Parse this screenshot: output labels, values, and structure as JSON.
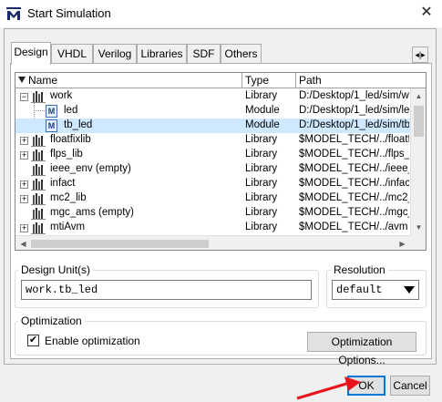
{
  "window": {
    "title": "Start Simulation",
    "close_label": "✕"
  },
  "tabs": [
    "Design",
    "VHDL",
    "Verilog",
    "Libraries",
    "SDF",
    "Others"
  ],
  "tab_scroll": "◂|▸",
  "list": {
    "columns": [
      "Name",
      "Type",
      "Path"
    ],
    "rows": [
      {
        "name": "work",
        "type": "Library",
        "path": "D:/Desktop/1_led/sim/wo"
      },
      {
        "name": "led",
        "type": "Module",
        "path": "D:/Desktop/1_led/sim/led"
      },
      {
        "name": "tb_led",
        "type": "Module",
        "path": "D:/Desktop/1_led/sim/tb_"
      },
      {
        "name": "floatfixlib",
        "type": "Library",
        "path": "$MODEL_TECH/../floatfix"
      },
      {
        "name": "flps_lib",
        "type": "Library",
        "path": "$MODEL_TECH/../flps_lib"
      },
      {
        "name": "ieee_env  (empty)",
        "type": "Library",
        "path": "$MODEL_TECH/../ieee_e"
      },
      {
        "name": "infact",
        "type": "Library",
        "path": "$MODEL_TECH/../infact"
      },
      {
        "name": "mc2_lib",
        "type": "Library",
        "path": "$MODEL_TECH/../mc2_lib"
      },
      {
        "name": "mgc_ams  (empty)",
        "type": "Library",
        "path": "$MODEL_TECH/../mgc_a"
      },
      {
        "name": "mtiAvm",
        "type": "Library",
        "path": "$MODEL_TECH/../avm"
      }
    ],
    "selected_row": 2
  },
  "design_unit": {
    "label": "Design Unit(s)",
    "value": "work.tb_led"
  },
  "resolution": {
    "label": "Resolution",
    "value": "default"
  },
  "optimization": {
    "label": "Optimization",
    "enable_label": "Enable optimization",
    "enabled": true,
    "check_mark": "✔",
    "options_button": "Optimization Options..."
  },
  "buttons": {
    "ok": "OK",
    "cancel": "Cancel"
  },
  "colors": {
    "selected_row": "#cde8ff",
    "default_button_border": "#0078d7",
    "annotation_arrow": "#e8141c"
  }
}
